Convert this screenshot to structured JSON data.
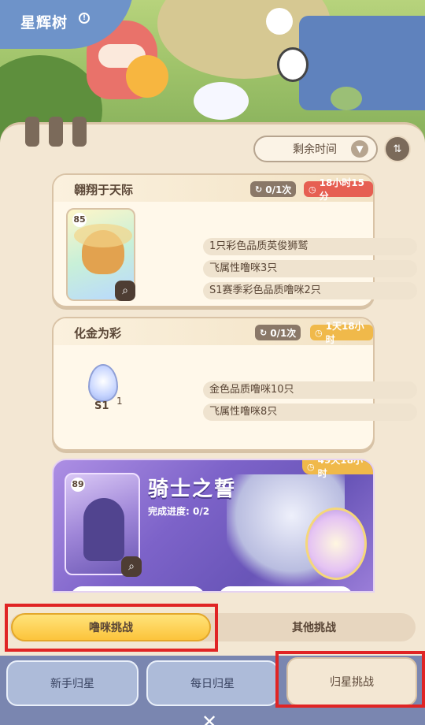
{
  "header": {
    "title": "星辉树",
    "info_icon": "info-icon"
  },
  "sort": {
    "label": "剩余时间",
    "chevron": "▼",
    "order_icon": "⇅"
  },
  "challenges": [
    {
      "title": "翱翔于天际",
      "count": "0/1次",
      "time": "18小时15分",
      "time_color": "#e65f52",
      "pet_level": "85",
      "requirements": [
        "1只彩色品质英俊狮鹫",
        "飞属性噜咪3只",
        "S1赛季彩色品质噜咪2只"
      ]
    },
    {
      "title": "化金为彩",
      "count": "0/1次",
      "time": "1天18小时",
      "time_color": "#f0b94a",
      "egg_label": "S1",
      "egg_count": "1",
      "requirements": [
        "金色品质噜咪10只",
        "飞属性噜咪8只"
      ]
    },
    {
      "title": "骑士之誓",
      "time": "49天18小时",
      "progress": "完成进度: 0/2",
      "pet_level": "89"
    }
  ],
  "segment_tabs": {
    "active": "噜咪挑战",
    "other": "其他挑战"
  },
  "bottom_tabs": [
    {
      "label": "新手归星"
    },
    {
      "label": "每日归星"
    },
    {
      "label": "归星挑战"
    }
  ],
  "close_glyph": "✕"
}
